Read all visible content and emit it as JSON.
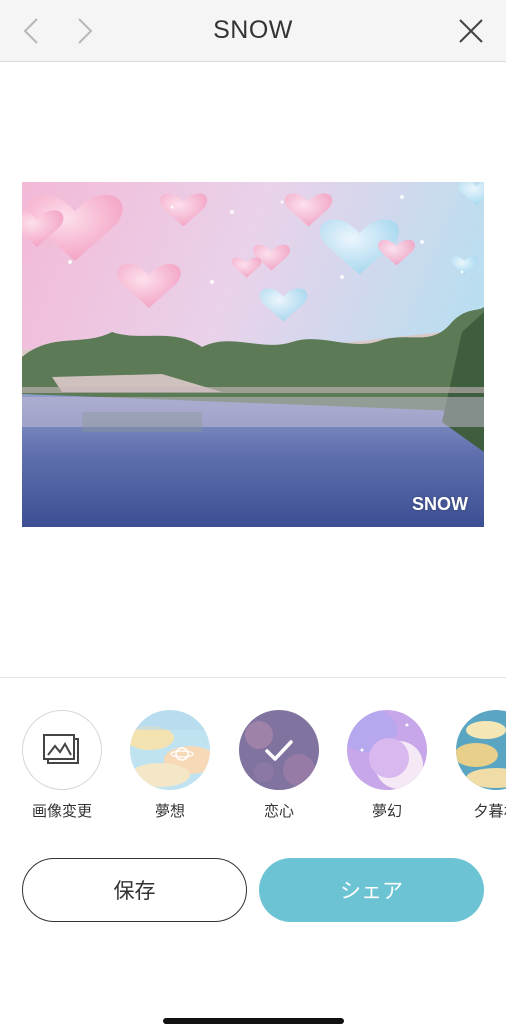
{
  "header": {
    "title": "SNOW",
    "back_icon": "chevron-left-icon",
    "forward_icon": "chevron-right-icon",
    "close_icon": "close-icon"
  },
  "photo": {
    "watermark": "SNOW"
  },
  "filters": [
    {
      "label": "画像変更",
      "icon": "change-image-icon",
      "selected": false
    },
    {
      "label": "夢想",
      "selected": false
    },
    {
      "label": "恋心",
      "selected": true
    },
    {
      "label": "夢幻",
      "selected": false
    },
    {
      "label": "夕暮れ",
      "selected": false
    }
  ],
  "actions": {
    "save_label": "保存",
    "share_label": "シェア"
  },
  "colors": {
    "accent": "#6cc3d4",
    "header_bg": "#f5f5f5"
  }
}
